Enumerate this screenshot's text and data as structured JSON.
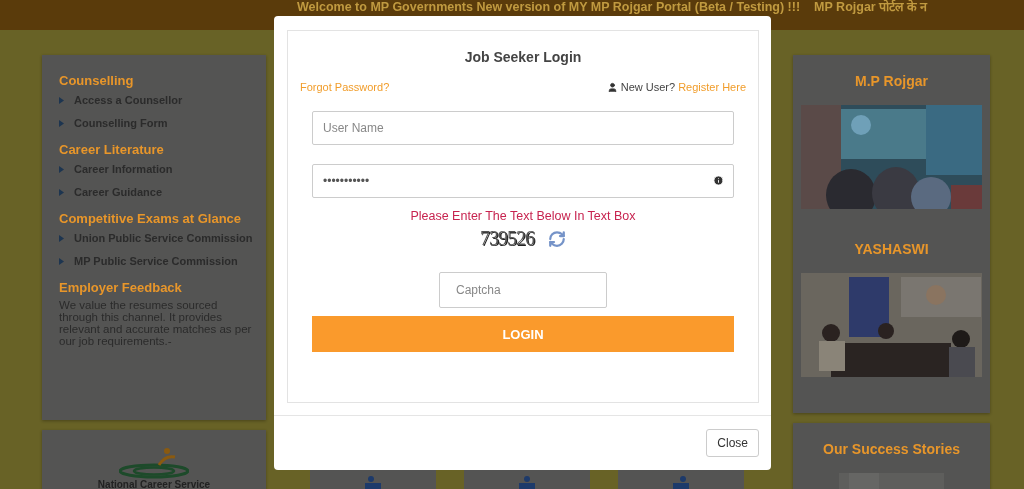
{
  "ticker": [
    "Welcome to MP Governments New version of MY MP Rojgar Portal (Beta / Testing) !!!",
    "MP Rojgar पोर्टल के न"
  ],
  "left_panel": {
    "sections": [
      {
        "heading": "Counselling",
        "items": [
          "Access a Counsellor",
          "Counselling Form"
        ]
      },
      {
        "heading": "Career Literature",
        "items": [
          "Career Information",
          "Career Guidance"
        ]
      },
      {
        "heading": "Competitive Exams at Glance",
        "items": [
          "Union Public Service Commission",
          "MP Public Service Commission"
        ]
      },
      {
        "heading": "Employer Feedback",
        "text": "We value the resumes sourced through this channel. It provides relevant and accurate matches as per our job requirements.-"
      }
    ]
  },
  "left_bottom_card": {
    "caption": "National Career Service"
  },
  "right_panel": {
    "blocks": [
      {
        "title": "M.P Rojgar"
      },
      {
        "title": "YASHASWI"
      }
    ]
  },
  "success_stories": {
    "title": "Our Success Stories"
  },
  "modal": {
    "title": "Job Seeker Login",
    "forgot_link": "Forgot Password?",
    "new_user_label": "New User?",
    "register_link": "Register Here",
    "username": {
      "placeholder": "User Name"
    },
    "password": {
      "value": "•••••••••••"
    },
    "captcha_prompt": "Please Enter The Text Below In Text Box",
    "captcha_code": "739526",
    "captcha": {
      "placeholder": "Captcha"
    },
    "login_button": "LOGIN",
    "close_button": "Close"
  }
}
